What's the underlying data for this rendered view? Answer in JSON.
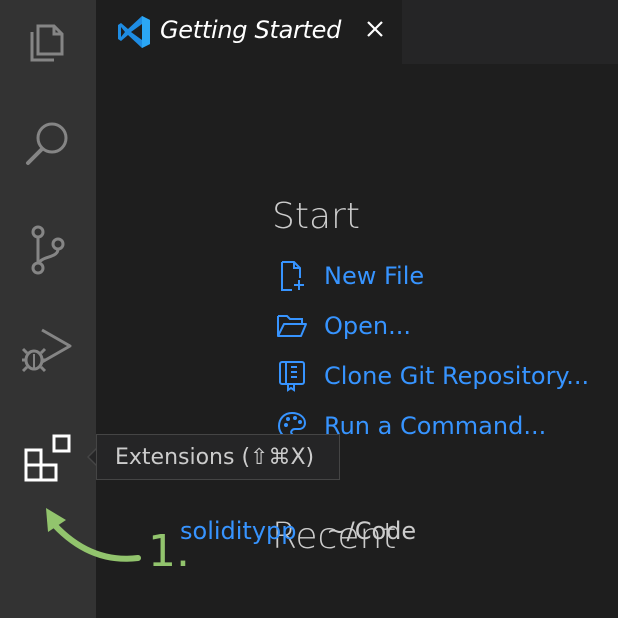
{
  "activity_bar": {
    "items": [
      {
        "name": "explorer",
        "icon": "files-icon"
      },
      {
        "name": "search",
        "icon": "search-icon"
      },
      {
        "name": "source-control",
        "icon": "source-control-icon"
      },
      {
        "name": "run-debug",
        "icon": "run-debug-icon"
      },
      {
        "name": "extensions",
        "icon": "extensions-icon"
      }
    ]
  },
  "tab": {
    "title": "Getting Started",
    "logo_icon": "vscode-logo-icon",
    "close_icon": "close-icon"
  },
  "start": {
    "title": "Start",
    "items": [
      {
        "label": "New File",
        "icon": "new-file-icon"
      },
      {
        "label": "Open...",
        "icon": "folder-open-icon"
      },
      {
        "label": "Clone Git Repository...",
        "icon": "repo-clone-icon"
      },
      {
        "label": "Run a Command...",
        "icon": "palette-icon"
      }
    ]
  },
  "recent": {
    "title": "Recent",
    "items": [
      {
        "name": "soliditypp",
        "path": "~/Code"
      }
    ]
  },
  "tooltip": {
    "text": "Extensions (⇧⌘X)"
  },
  "annotation": {
    "label": "1.",
    "color": "#92c46d"
  },
  "colors": {
    "link": "#3794ff",
    "activity_bar_bg": "#333333",
    "editor_bg": "#1e1e1e",
    "icon_inactive": "#858585",
    "icon_active": "#ffffff"
  }
}
